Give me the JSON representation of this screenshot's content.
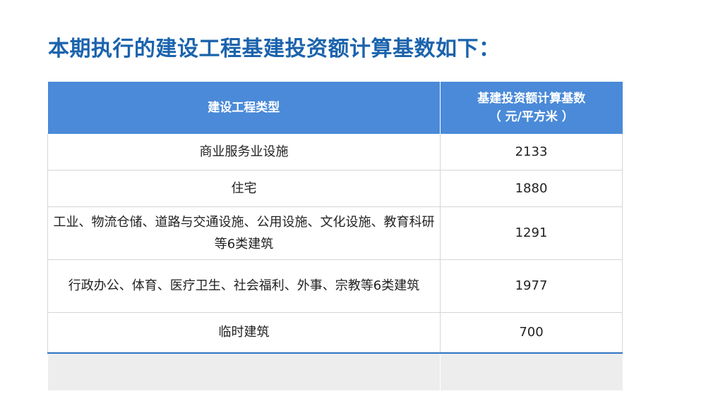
{
  "title": "本期执行的建设工程基建投资额计算基数如下：",
  "table": {
    "header": {
      "type": "建设工程类型",
      "base_line1": "基建投资额计算基数",
      "base_line2": "（ 元/平方米 ）"
    },
    "rows": [
      {
        "type": "商业服务业设施",
        "value": "2133"
      },
      {
        "type": "住宅",
        "value": "1880"
      },
      {
        "type": "工业、物流仓储、道路与交通设施、公用设施、文化设施、教育科研等6类建筑",
        "value": "1291"
      },
      {
        "type": "行政办公、体育、医疗卫生、社会福利、外事、宗教等6类建筑",
        "value": "1977"
      },
      {
        "type": "临时建筑",
        "value": "700"
      }
    ]
  },
  "colors": {
    "title": "#1b63ad",
    "header_bg": "#4a8ad8",
    "footer_bg": "#ededed"
  }
}
